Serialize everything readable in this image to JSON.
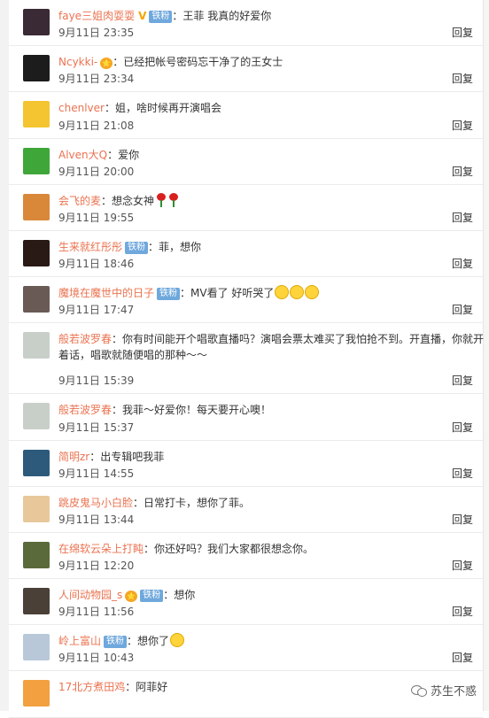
{
  "reply_label": "回复",
  "comments": [
    {
      "name": "faye三姐肉耍耍",
      "badge": "铁粉",
      "vip": "V",
      "text": "：王菲 我真的好爱你",
      "time": "9月11日 23:35",
      "avatar_color": "#3a2a35"
    },
    {
      "name": "Ncykki-",
      "vip_icon": "⭐",
      "text": "：已经把帐号密码忘干净了的王女士",
      "time": "9月11日 23:34",
      "avatar_color": "#1c1c1c"
    },
    {
      "name": "chenlver",
      "text": "：姐，啥时候再开演唱会",
      "time": "9月11日 21:08",
      "avatar_color": "#f4c531"
    },
    {
      "name": "Alven大Q",
      "text": "：爱你",
      "time": "9月11日 20:00",
      "avatar_color": "#3fa63a"
    },
    {
      "name": "会飞的麦",
      "text": "：想念女神",
      "roses": 2,
      "time": "9月11日 19:55",
      "avatar_color": "#d9883a"
    },
    {
      "name": "生来就红彤彤",
      "badge": "铁粉",
      "text": "：菲，想你",
      "time": "9月11日 18:46",
      "avatar_color": "#2a1a15"
    },
    {
      "name": "魔境在魔世中的日子",
      "badge": "铁粉",
      "text": "：MV看了 好听哭了",
      "emojis": 3,
      "time": "9月11日 17:47",
      "avatar_color": "#6a5a55"
    },
    {
      "name": "般若波罗春",
      "text": "：你有时间能开个唱歌直播吗？演唱会票太难买了我怕抢不到。开直播，你就开着话，唱歌就随便唱的那种～～",
      "time": "9月11日 15:39",
      "avatar_color": "#c8cfc8",
      "tall": true
    },
    {
      "name": "般若波罗春",
      "text": "：我菲～好爱你！每天要开心噢！",
      "time": "9月11日 15:37",
      "avatar_color": "#c8cfc8"
    },
    {
      "name": "简明zr",
      "text": "：出专辑吧我菲",
      "time": "9月11日 14:55",
      "avatar_color": "#2d5a7a"
    },
    {
      "name": "跳皮鬼马小白脸",
      "text": "：日常打卡，想你了菲。",
      "time": "9月11日 13:44",
      "avatar_color": "#e8c89a"
    },
    {
      "name": "在绵软云朵上打盹",
      "text": "：你还好吗？我们大家都很想念你。",
      "time": "9月11日 12:20",
      "avatar_color": "#5a6a3a"
    },
    {
      "name": "人间动物园_s",
      "vip_icon": "⭐",
      "badge": "铁粉",
      "text": "：想你",
      "time": "9月11日 11:56",
      "avatar_color": "#4a4038"
    },
    {
      "name": "岭上富山",
      "badge": "铁粉",
      "text": "：想你了",
      "emojis": 1,
      "time": "9月11日 10:43",
      "avatar_color": "#b8c8d8"
    },
    {
      "name": "17北方煮田鸡",
      "text": "：阿菲好",
      "time": "",
      "avatar_color": "#f2a040"
    }
  ],
  "watermark": "苏生不惑"
}
